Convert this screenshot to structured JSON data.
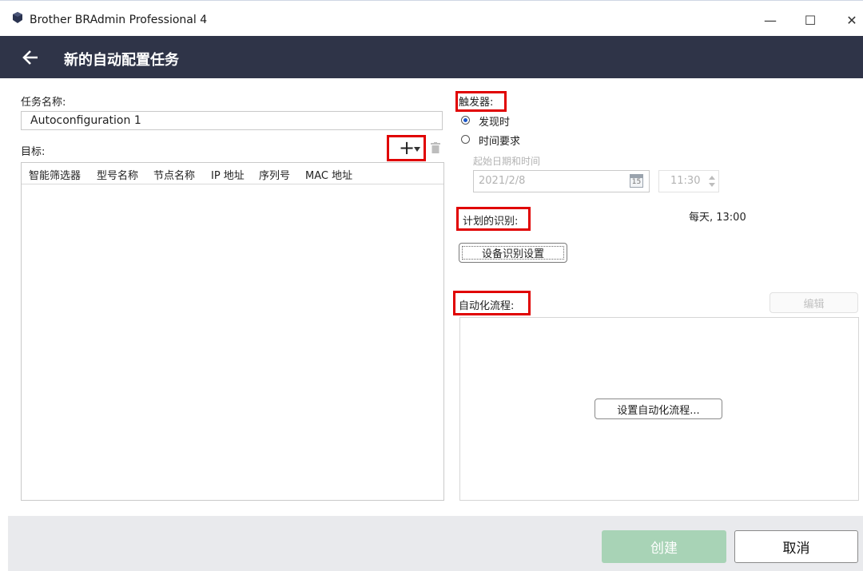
{
  "window": {
    "title": "Brother BRAdmin Professional 4",
    "minimize": "—",
    "maximize": "☐",
    "close": "✕"
  },
  "header": {
    "title": "新的自动配置任务"
  },
  "form": {
    "task_name_label": "任务名称:",
    "task_name_value": "Autoconfiguration 1",
    "target_label": "目标:",
    "add_symbol": "+",
    "table_columns": [
      "智能筛选器",
      "型号名称",
      "节点名称",
      "IP 地址",
      "序列号",
      "MAC 地址"
    ]
  },
  "trigger": {
    "label": "触发器:",
    "option_discovery": "发现时",
    "option_schedule": "时间要求",
    "selected": "发现时",
    "start_datetime_label": "起始日期和时间",
    "date_value": "2021/2/8",
    "calendar_day": "15",
    "time_value": "11:30"
  },
  "identification": {
    "label": "计划的识别:",
    "schedule_value": "每天, 13:00",
    "settings_button": "设备识别设置"
  },
  "automation": {
    "label": "自动化流程:",
    "edit_button": "编辑",
    "setup_button": "设置自动化流程..."
  },
  "footer": {
    "create_button": "创建",
    "cancel_button": "取消"
  },
  "colors": {
    "header_bg": "#2f3448",
    "highlight_red": "#e00000",
    "create_disabled": "#a8d3b6",
    "radio_selected": "#1a56c9"
  }
}
